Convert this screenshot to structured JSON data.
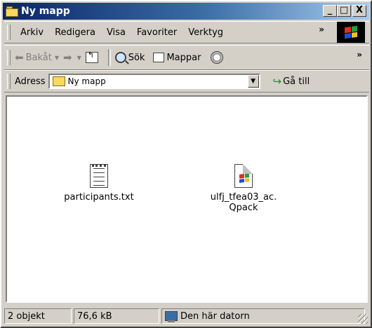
{
  "window": {
    "title": "Ny mapp"
  },
  "titlebar": {
    "min": "_",
    "max": "□",
    "close": "X"
  },
  "menu": {
    "items": [
      "Arkiv",
      "Redigera",
      "Visa",
      "Favoriter",
      "Verktyg"
    ],
    "more": "»"
  },
  "toolbar": {
    "back": "Bakåt",
    "search": "Sök",
    "folders": "Mappar",
    "more": "»"
  },
  "address": {
    "label": "Adress",
    "value": "Ny mapp",
    "go": "Gå till"
  },
  "files": [
    {
      "name": "participants.txt",
      "icon": "text-file-icon"
    },
    {
      "name_line1": "ulfj_tfea03_ac.",
      "name_line2": "Qpack",
      "icon": "qpack-file-icon"
    }
  ],
  "status": {
    "count": "2 objekt",
    "size": "76,6 kB",
    "location": "Den här datorn"
  }
}
